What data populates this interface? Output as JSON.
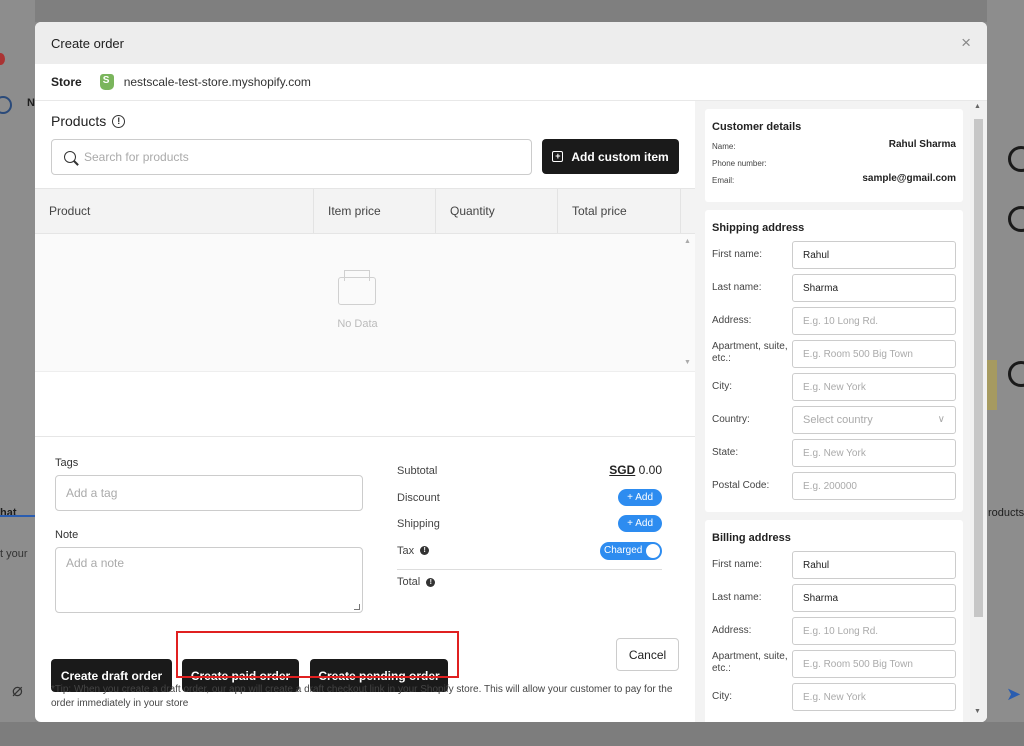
{
  "background": {
    "left_tab": "hat",
    "left_text": "t your",
    "right_text": "roducts",
    "left_letter": "N"
  },
  "modal": {
    "title": "Create order",
    "close": "×"
  },
  "store": {
    "label": "Store",
    "name": "nestscale-test-store.myshopify.com"
  },
  "products": {
    "title": "Products",
    "search_placeholder": "Search for products",
    "add_custom_label": "Add custom item",
    "columns": [
      "Product",
      "Item price",
      "Quantity",
      "Total price"
    ],
    "empty_text": "No Data"
  },
  "tags": {
    "label": "Tags",
    "placeholder": "Add a tag"
  },
  "note": {
    "label": "Note",
    "placeholder": "Add a note"
  },
  "summary": {
    "subtotal_label": "Subtotal",
    "currency": "SGD",
    "subtotal_value": "0.00",
    "discount_label": "Discount",
    "discount_btn": "+ Add",
    "shipping_label": "Shipping",
    "shipping_btn": "+ Add",
    "tax_label": "Tax",
    "tax_toggle": "Charged",
    "total_label": "Total"
  },
  "actions": {
    "draft": "Create draft order",
    "paid": "Create paid order",
    "pending": "Create pending order",
    "cancel": "Cancel"
  },
  "tip": "*Tip: When you create a draft order, our app will create a draft checkout link in your Shopify store. This will allow your customer to pay for the order immediately in your store",
  "customer": {
    "title": "Customer details",
    "name_label": "Name:",
    "name_value": "Rahul Sharma",
    "phone_label": "Phone number:",
    "phone_value": "",
    "email_label": "Email:",
    "email_value": "sample@gmail.com"
  },
  "shipping_address": {
    "title": "Shipping address",
    "first_name_label": "First name:",
    "first_name_value": "Rahul",
    "last_name_label": "Last name:",
    "last_name_value": "Sharma",
    "address_label": "Address:",
    "address_placeholder": "E.g. 10 Long Rd.",
    "apartment_label": "Apartment, suite, etc.:",
    "apartment_placeholder": "E.g. Room 500 Big Town",
    "city_label": "City:",
    "city_placeholder": "E.g. New York",
    "country_label": "Country:",
    "country_placeholder": "Select country",
    "state_label": "State:",
    "state_placeholder": "E.g. New York",
    "postal_label": "Postal Code:",
    "postal_placeholder": "E.g. 200000"
  },
  "billing_address": {
    "title": "Billing address",
    "first_name_label": "First name:",
    "first_name_value": "Rahul",
    "last_name_label": "Last name:",
    "last_name_value": "Sharma",
    "address_label": "Address:",
    "address_placeholder": "E.g. 10 Long Rd.",
    "apartment_label": "Apartment, suite, etc.:",
    "apartment_placeholder": "E.g. Room 500 Big Town",
    "city_label": "City:",
    "city_placeholder": "E.g. New York"
  },
  "colors": {
    "primary_dark": "#1a1a1a",
    "accent_blue": "#2d8cf0",
    "highlight_red": "#e02020"
  }
}
